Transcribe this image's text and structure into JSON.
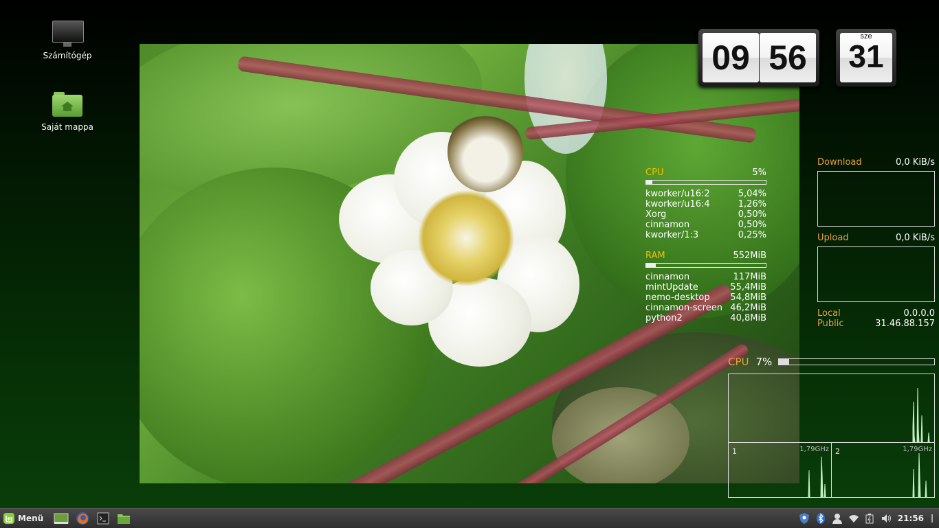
{
  "desktop": {
    "icons": [
      {
        "label": "Számítógép",
        "icon": "computer-icon"
      },
      {
        "label": "Saját mappa",
        "icon": "home-folder-icon"
      }
    ]
  },
  "clock": {
    "hours": "09",
    "minutes": "56"
  },
  "calendar": {
    "month": "sze",
    "day": "31"
  },
  "sysmon": {
    "cpu": {
      "label": "CPU",
      "value": "5%",
      "level": 0.05
    },
    "cpu_procs": [
      {
        "name": "kworker/u16:2",
        "value": "5,04%"
      },
      {
        "name": "kworker/u16:4",
        "value": "1,26%"
      },
      {
        "name": "Xorg",
        "value": "0,50%"
      },
      {
        "name": "cinnamon",
        "value": "0,50%"
      },
      {
        "name": "kworker/1:3",
        "value": "0,25%"
      }
    ],
    "ram": {
      "label": "RAM",
      "value": "552MiB",
      "level": 0.08
    },
    "ram_procs": [
      {
        "name": "cinnamon",
        "value": "117MiB"
      },
      {
        "name": "mintUpdate",
        "value": "55,4MiB"
      },
      {
        "name": "nemo-desktop",
        "value": "54,8MiB"
      },
      {
        "name": "cinnamon-screen",
        "value": "46,2MiB"
      },
      {
        "name": "python2",
        "value": "40,8MiB"
      }
    ]
  },
  "network": {
    "download_label": "Download",
    "download_value": "0,0 KiB/s",
    "upload_label": "Upload",
    "upload_value": "0,0 KiB/s",
    "local_label": "Local",
    "local_value": "0.0.0.0",
    "public_label": "Public",
    "public_value": "31.46.88.157"
  },
  "cpu_graph": {
    "label": "CPU",
    "value": "7%",
    "level": 0.07,
    "core1_label": "1",
    "core1_freq": "1,79GHz",
    "core2_label": "2",
    "core2_freq": "1,79GHz"
  },
  "taskbar": {
    "menu_label": "Menü",
    "time": "21:56",
    "launchers": [
      "show-desktop-icon",
      "firefox-icon",
      "terminal-icon",
      "files-icon"
    ],
    "tray": [
      "shield-icon",
      "bluetooth-icon",
      "user-icon",
      "wifi-icon",
      "battery-icon",
      "volume-icon"
    ]
  },
  "colors": {
    "accent_yellow": "#f0c000",
    "accent_orange": "#e8a23c",
    "graph_green": "#bff0bf"
  }
}
